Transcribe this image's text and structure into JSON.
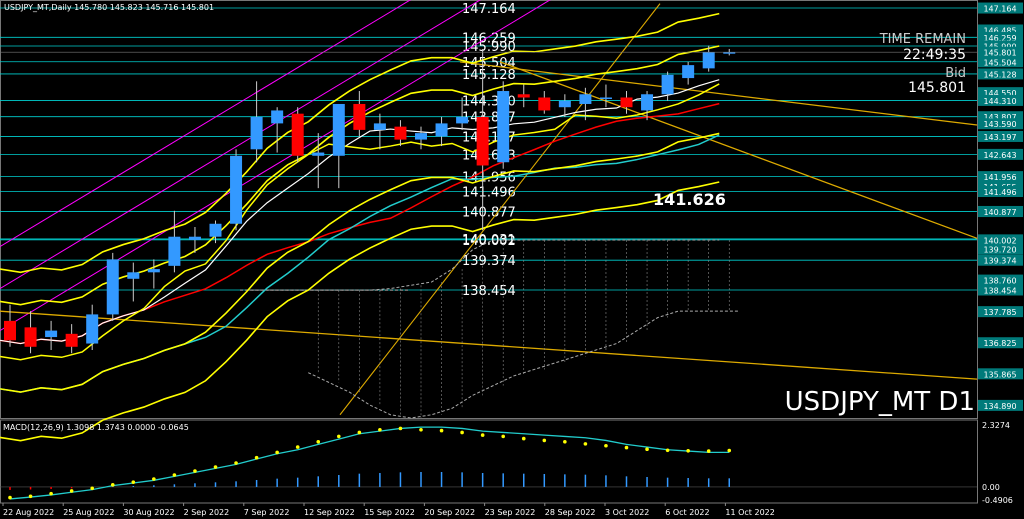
{
  "chart_data": {
    "type": "candlestick",
    "symbol": "USDJPY_MT,Daily",
    "ohlc_header": "145.780 145.823 145.716 145.801",
    "watermark": "USDJPY_MT D1",
    "time_remain_label": "TIME REMAIN",
    "time_remain": "22:49:35",
    "bid_label": "Bid",
    "bid": "145.801",
    "highlight_price": "141.626",
    "price_range": [
      134.5,
      147.35
    ],
    "price_axis": [
      "147.164",
      "146.485",
      "146.259",
      "145.990",
      "145.801",
      "145.504",
      "145.128",
      "144.550",
      "144.310",
      "143.807",
      "143.590",
      "143.197",
      "142.643",
      "141.956",
      "141.655",
      "141.496",
      "140.880",
      "140.877",
      "140.002",
      "139.720",
      "139.374",
      "138.760",
      "138.454",
      "137.785",
      "136.825",
      "135.865",
      "134.890"
    ],
    "level_labels": [
      "147.164",
      "146.259",
      "145.990",
      "145.504",
      "145.128",
      "144.310",
      "143.807",
      "143.197",
      "142.643",
      "141.956",
      "141.496",
      "140.877",
      "140.002",
      "140.031",
      "139.374",
      "138.454"
    ],
    "candles": [
      {
        "o": 137.5,
        "h": 138.0,
        "l": 136.7,
        "c": 136.9
      },
      {
        "o": 137.3,
        "h": 137.8,
        "l": 136.5,
        "c": 136.7
      },
      {
        "o": 137.0,
        "h": 137.5,
        "l": 136.6,
        "c": 137.2
      },
      {
        "o": 137.1,
        "h": 137.4,
        "l": 136.5,
        "c": 136.7
      },
      {
        "o": 136.8,
        "h": 138.0,
        "l": 136.6,
        "c": 137.7
      },
      {
        "o": 137.7,
        "h": 139.6,
        "l": 137.5,
        "c": 139.4
      },
      {
        "o": 138.8,
        "h": 139.3,
        "l": 138.1,
        "c": 139.0
      },
      {
        "o": 139.0,
        "h": 139.4,
        "l": 138.5,
        "c": 139.1
      },
      {
        "o": 139.2,
        "h": 140.9,
        "l": 139.0,
        "c": 140.1
      },
      {
        "o": 140.0,
        "h": 140.4,
        "l": 139.6,
        "c": 140.1
      },
      {
        "o": 140.1,
        "h": 140.6,
        "l": 139.9,
        "c": 140.5
      },
      {
        "o": 140.5,
        "h": 142.8,
        "l": 140.3,
        "c": 142.6
      },
      {
        "o": 142.8,
        "h": 144.9,
        "l": 142.4,
        "c": 143.8
      },
      {
        "o": 143.6,
        "h": 144.1,
        "l": 142.7,
        "c": 144.0
      },
      {
        "o": 143.9,
        "h": 144.1,
        "l": 142.4,
        "c": 142.6
      },
      {
        "o": 142.6,
        "h": 143.3,
        "l": 141.6,
        "c": 142.7
      },
      {
        "o": 142.6,
        "h": 144.2,
        "l": 141.6,
        "c": 144.2
      },
      {
        "o": 144.2,
        "h": 144.6,
        "l": 143.2,
        "c": 143.4
      },
      {
        "o": 143.4,
        "h": 143.9,
        "l": 142.8,
        "c": 143.6
      },
      {
        "o": 143.5,
        "h": 143.7,
        "l": 142.9,
        "c": 143.1
      },
      {
        "o": 143.1,
        "h": 143.5,
        "l": 142.8,
        "c": 143.3
      },
      {
        "o": 143.2,
        "h": 143.8,
        "l": 142.9,
        "c": 143.6
      },
      {
        "o": 143.6,
        "h": 144.4,
        "l": 143.4,
        "c": 143.8
      },
      {
        "o": 143.8,
        "h": 145.9,
        "l": 140.3,
        "c": 142.3
      },
      {
        "o": 142.4,
        "h": 144.9,
        "l": 142.2,
        "c": 144.6
      },
      {
        "o": 144.5,
        "h": 144.8,
        "l": 144.1,
        "c": 144.4
      },
      {
        "o": 144.4,
        "h": 144.6,
        "l": 143.9,
        "c": 144.0
      },
      {
        "o": 144.1,
        "h": 144.5,
        "l": 143.8,
        "c": 144.3
      },
      {
        "o": 144.2,
        "h": 144.7,
        "l": 143.7,
        "c": 144.5
      },
      {
        "o": 144.4,
        "h": 144.8,
        "l": 144.1,
        "c": 144.4
      },
      {
        "o": 144.4,
        "h": 144.6,
        "l": 143.9,
        "c": 144.1
      },
      {
        "o": 144.0,
        "h": 144.6,
        "l": 143.7,
        "c": 144.5
      },
      {
        "o": 144.5,
        "h": 145.2,
        "l": 144.3,
        "c": 145.1
      },
      {
        "o": 145.0,
        "h": 145.5,
        "l": 144.8,
        "c": 145.4
      },
      {
        "o": 145.3,
        "h": 146.0,
        "l": 145.2,
        "c": 145.8
      },
      {
        "o": 145.8,
        "h": 145.9,
        "l": 145.7,
        "c": 145.8
      }
    ],
    "colors": {
      "bull": "#3399ff",
      "bear": "#ff0000",
      "ma_yellow": "#ffff00",
      "ma_white": "#ffffff",
      "ma_red": "#ff0000",
      "ma_cyan": "#22cccc",
      "trend": "#ddaa00",
      "band": "#ff00ff",
      "grid_level": "#00d0d0",
      "axis_label": "#007a7a"
    },
    "macd": {
      "label": "MACD(12,26,9) 1.3098 1.3743 0.0000 -0.0645",
      "axis": [
        "2.3274",
        "0.00",
        "-0.4906"
      ],
      "range": [
        -0.49,
        2.33
      ],
      "main": [
        -0.45,
        -0.38,
        -0.3,
        -0.2,
        -0.1,
        0.05,
        0.15,
        0.25,
        0.4,
        0.55,
        0.7,
        0.85,
        1.05,
        1.25,
        1.4,
        1.6,
        1.8,
        2.0,
        2.1,
        2.2,
        2.25,
        2.25,
        2.2,
        2.1,
        2.05,
        2.0,
        1.95,
        1.9,
        1.85,
        1.75,
        1.6,
        1.5,
        1.4,
        1.35,
        1.3,
        1.3
      ],
      "signal": [
        -0.4,
        -0.35,
        -0.25,
        -0.15,
        -0.05,
        0.08,
        0.18,
        0.3,
        0.45,
        0.6,
        0.75,
        0.9,
        1.1,
        1.3,
        1.5,
        1.7,
        1.9,
        2.05,
        2.15,
        2.2,
        2.15,
        2.12,
        2.05,
        1.95,
        1.9,
        1.82,
        1.75,
        1.7,
        1.62,
        1.55,
        1.48,
        1.42,
        1.38,
        1.36,
        1.35,
        1.37
      ]
    },
    "dates": [
      "22 Aug 2022",
      "25 Aug 2022",
      "30 Aug 2022",
      "2 Sep 2022",
      "7 Sep 2022",
      "12 Sep 2022",
      "15 Sep 2022",
      "20 Sep 2022",
      "23 Sep 2022",
      "28 Sep 2022",
      "3 Oct 2022",
      "6 Oct 2022",
      "11 Oct 2022"
    ]
  }
}
